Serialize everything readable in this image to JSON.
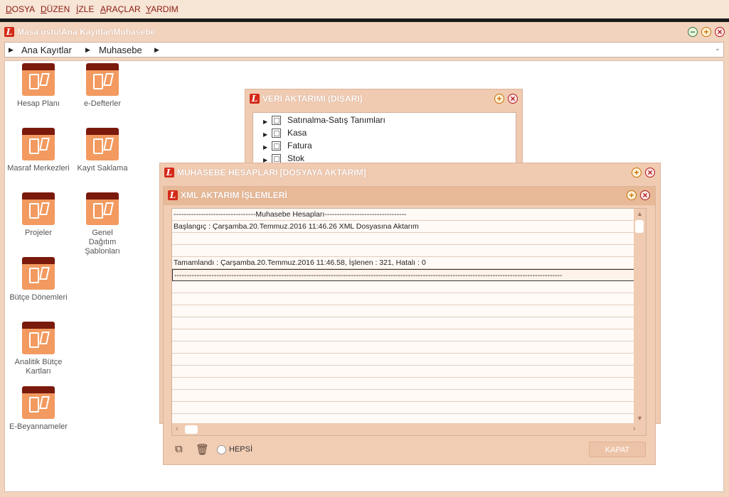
{
  "menu": {
    "items": [
      {
        "underline": "D",
        "rest": "OSYA"
      },
      {
        "underline": "D",
        "rest": "ÜZEN"
      },
      {
        "underline": "İ",
        "rest": "ZLE"
      },
      {
        "underline": "A",
        "rest": "RAÇLAR"
      },
      {
        "underline": "Y",
        "rest": "ARDIM"
      }
    ]
  },
  "main_window": {
    "title": "Masa üstü\\Ana Kayıtlar\\Muhasebe",
    "logo_letter": "L",
    "breadcrumb": [
      "Ana Kayıtlar",
      "Muhasebe"
    ]
  },
  "desktop_icons": [
    {
      "label": "Hesap Planı"
    },
    {
      "label": "e-Defterler"
    },
    {
      "label": "Masraf Merkezleri"
    },
    {
      "label": "Kayıt Saklama"
    },
    {
      "label": "Projeler"
    },
    {
      "label": "Genel Dağıtım Şablonları"
    },
    {
      "label": "Bütçe Dönemleri"
    },
    {
      "label": "Analitik Bütçe Kartları"
    },
    {
      "label": "E-Beyannameler"
    }
  ],
  "veri_window": {
    "title": "VERİ AKTARIMI (DIŞARI)",
    "tree": [
      "Satınalma-Satış Tanımları",
      "Kasa",
      "Fatura",
      "Stok"
    ]
  },
  "muhasebe_window": {
    "title": "MUHASEBE HESAPLARI [DOSYAYA AKTARIM]"
  },
  "xml_window": {
    "title": "XML AKTARIM İŞLEMLERİ",
    "log_rows": [
      "---------------------------------Muhasebe Hesapları---------------------------------",
      "Başlangıç : Çarşamba.20.Temmuz.2016    11:46.26   XML Dosyasına Aktarım",
      "",
      "",
      "Tamamlandı : Çarşamba.20.Temmuz.2016    11:46.58,  İşlenen : 321, Hatalı : 0",
      "------------------------------------------------------------------------------------------------------------------------------------------------------------",
      "",
      "",
      "",
      "",
      "",
      "",
      "",
      "",
      "",
      "",
      "",
      ""
    ],
    "hepsi_label": "HEPSİ",
    "kapat_label": "KAPAT"
  },
  "colors": {
    "menu_text": "#8a1a10",
    "window_bg": "#f0cbb1",
    "logo_red": "#d42a1a"
  }
}
